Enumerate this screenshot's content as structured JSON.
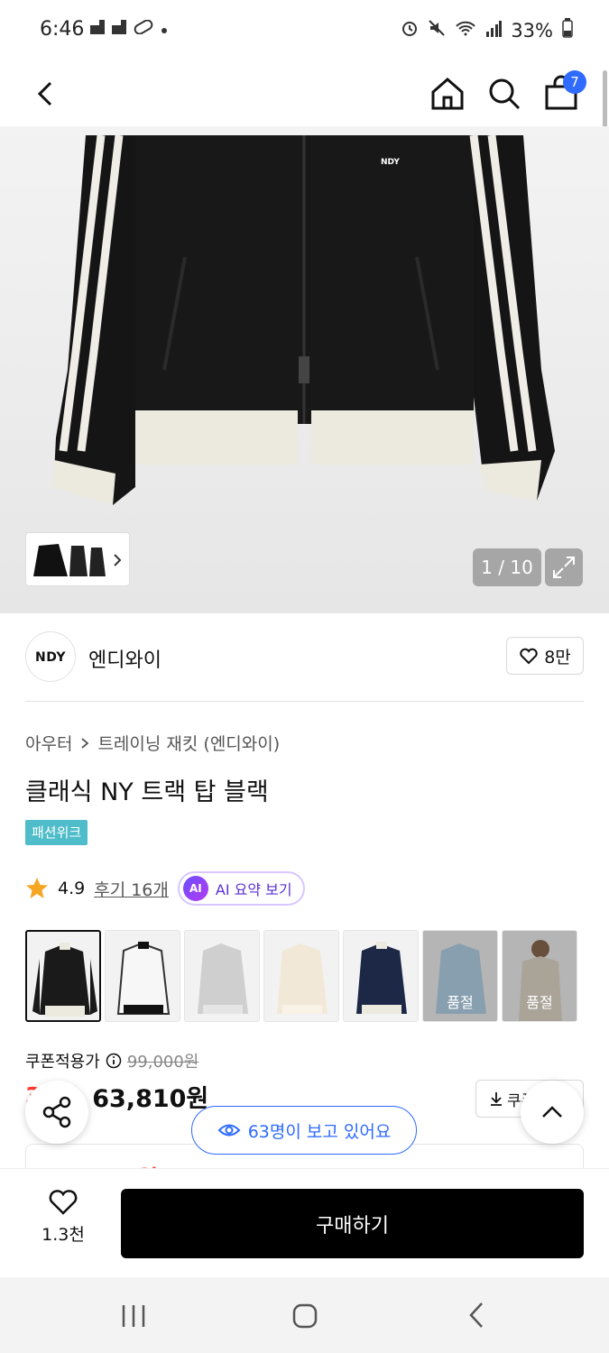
{
  "status_bar": {
    "time": "6:46",
    "battery": "33%"
  },
  "nav": {
    "cart_count": "7"
  },
  "gallery": {
    "page_counter": "1 / 10",
    "hero_logo": "NDY"
  },
  "brand": {
    "logo": "NDY",
    "name": "엔디와이",
    "likes": "8만"
  },
  "breadcrumb": {
    "category": "아우터",
    "subcategory": "트레이닝 재킷 (엔디와이)"
  },
  "product": {
    "title": "클래식 NY 트랙 탑 블랙",
    "event_badge": "패션위크",
    "rating": "4.9",
    "reviews": "후기 16개",
    "ai_badge": "AI",
    "ai_summary": "AI 요약 보기"
  },
  "color_options": [
    {
      "name": "black",
      "soldout": ""
    },
    {
      "name": "white",
      "soldout": ""
    },
    {
      "name": "gray",
      "soldout": ""
    },
    {
      "name": "cream",
      "soldout": ""
    },
    {
      "name": "navy",
      "soldout": ""
    },
    {
      "name": "sky",
      "soldout": "품절"
    },
    {
      "name": "beige",
      "soldout": "품절"
    }
  ],
  "pricing": {
    "coupon_label": "쿠폰적용가",
    "original_price": "99,000원",
    "discount": "35%",
    "price": "63,810원",
    "coupon_button": "쿠폰",
    "peek_price": "62,500원"
  },
  "viewers": {
    "text": "63명이 보고 있어요"
  },
  "bottom": {
    "wish_count": "1.3천",
    "buy_label": "구매하기"
  },
  "colors": {
    "accent_blue": "#2f6bff",
    "discount_red": "#ff3b30",
    "badge_teal": "#4fbcc9"
  }
}
